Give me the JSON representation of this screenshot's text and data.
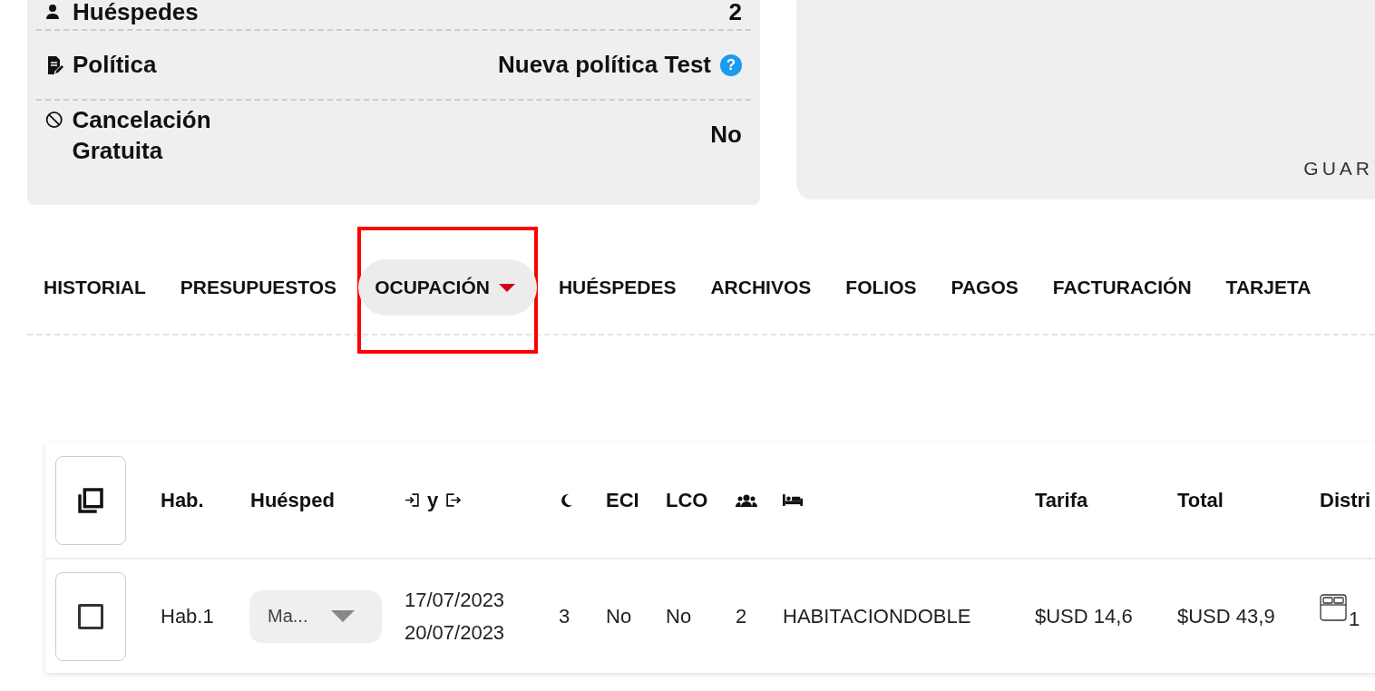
{
  "summary": {
    "rows": [
      {
        "kind": "guests",
        "label": "Huéspedes",
        "value": "2"
      },
      {
        "kind": "policy",
        "label": "Política",
        "value": "Nueva política Test",
        "help": "?"
      },
      {
        "kind": "cancellation",
        "label": "Cancelación Gratuita",
        "value": "No"
      }
    ]
  },
  "side_panel": {
    "button": "GUAR"
  },
  "tabs": [
    {
      "label": "HISTORIAL",
      "selected": false,
      "dropdown": false,
      "highlighted": false
    },
    {
      "label": "PRESUPUESTOS",
      "selected": false,
      "dropdown": false,
      "highlighted": false
    },
    {
      "label": "OCUPACIÓN",
      "selected": true,
      "dropdown": true,
      "highlighted": true
    },
    {
      "label": "HUÉSPEDES",
      "selected": false,
      "dropdown": false,
      "highlighted": false
    },
    {
      "label": "ARCHIVOS",
      "selected": false,
      "dropdown": false,
      "highlighted": false
    },
    {
      "label": "FOLIOS",
      "selected": false,
      "dropdown": false,
      "highlighted": false
    },
    {
      "label": "PAGOS",
      "selected": false,
      "dropdown": false,
      "highlighted": false
    },
    {
      "label": "FACTURACIÓN",
      "selected": false,
      "dropdown": false,
      "highlighted": false
    },
    {
      "label": "TARJETA",
      "selected": false,
      "dropdown": false,
      "highlighted": false
    }
  ],
  "table": {
    "columns": [
      {
        "kind": "select"
      },
      {
        "kind": "text",
        "label": "Hab."
      },
      {
        "kind": "text",
        "label": "Huésped"
      },
      {
        "kind": "dates",
        "label": "y"
      },
      {
        "kind": "nights"
      },
      {
        "kind": "text",
        "label": "ECI"
      },
      {
        "kind": "text",
        "label": "LCO"
      },
      {
        "kind": "guests"
      },
      {
        "kind": "room_type"
      },
      {
        "kind": "text",
        "label": "Tarifa"
      },
      {
        "kind": "text",
        "label": "Total"
      },
      {
        "kind": "text",
        "label": "Distri"
      }
    ],
    "rows": [
      {
        "selected": false,
        "room": "Hab.1",
        "guest": "Ma...",
        "check_in": "17/07/2023",
        "check_out": "20/07/2023",
        "nights": "3",
        "eci": "No",
        "lco": "No",
        "guests": "2",
        "room_type": "HABITACIONDOBLE",
        "rate": "$USD 14,6",
        "total": "$USD 43,9",
        "beds": "1"
      }
    ]
  }
}
